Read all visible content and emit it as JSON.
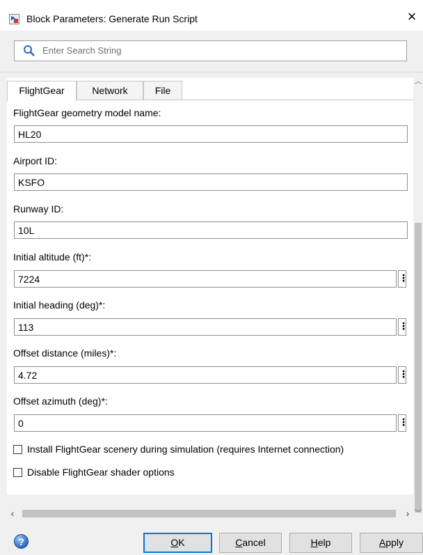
{
  "window": {
    "title": "Block Parameters: Generate Run Script",
    "icon": "simulink-block-icon",
    "close": "×"
  },
  "search": {
    "placeholder": "Enter Search String",
    "value": ""
  },
  "tabs": [
    {
      "label": "FlightGear",
      "active": true
    },
    {
      "label": "Network",
      "active": false
    },
    {
      "label": "File",
      "active": false
    }
  ],
  "params": {
    "model_name": {
      "label": "FlightGear geometry model name:",
      "value": "HL20"
    },
    "airport_id": {
      "label": "Airport ID:",
      "value": "KSFO"
    },
    "runway_id": {
      "label": "Runway ID:",
      "value": "10L"
    },
    "altitude": {
      "label": "Initial altitude (ft)*:",
      "value": "7224"
    },
    "heading": {
      "label": "Initial heading (deg)*:",
      "value": "113"
    },
    "offset_distance": {
      "label": "Offset distance (miles)*:",
      "value": "4.72"
    },
    "offset_azimuth": {
      "label": "Offset azimuth (deg)*:",
      "value": "0"
    }
  },
  "checkboxes": {
    "install_scenery": {
      "label": "Install FlightGear scenery during simulation (requires Internet connection)",
      "checked": false
    },
    "disable_shader": {
      "label": "Disable FlightGear shader options",
      "checked": false
    }
  },
  "more_button_glyph": "⋮",
  "buttons": {
    "ok": {
      "accel": "O",
      "rest": "K"
    },
    "cancel": {
      "accel": "C",
      "rest": "ancel"
    },
    "help": {
      "accel": "H",
      "rest": "elp"
    },
    "apply": {
      "accel": "A",
      "rest": "pply"
    }
  },
  "colors": {
    "accent": "#0078d7",
    "panel": "#ffffff",
    "chrome": "#f0f0f0"
  }
}
